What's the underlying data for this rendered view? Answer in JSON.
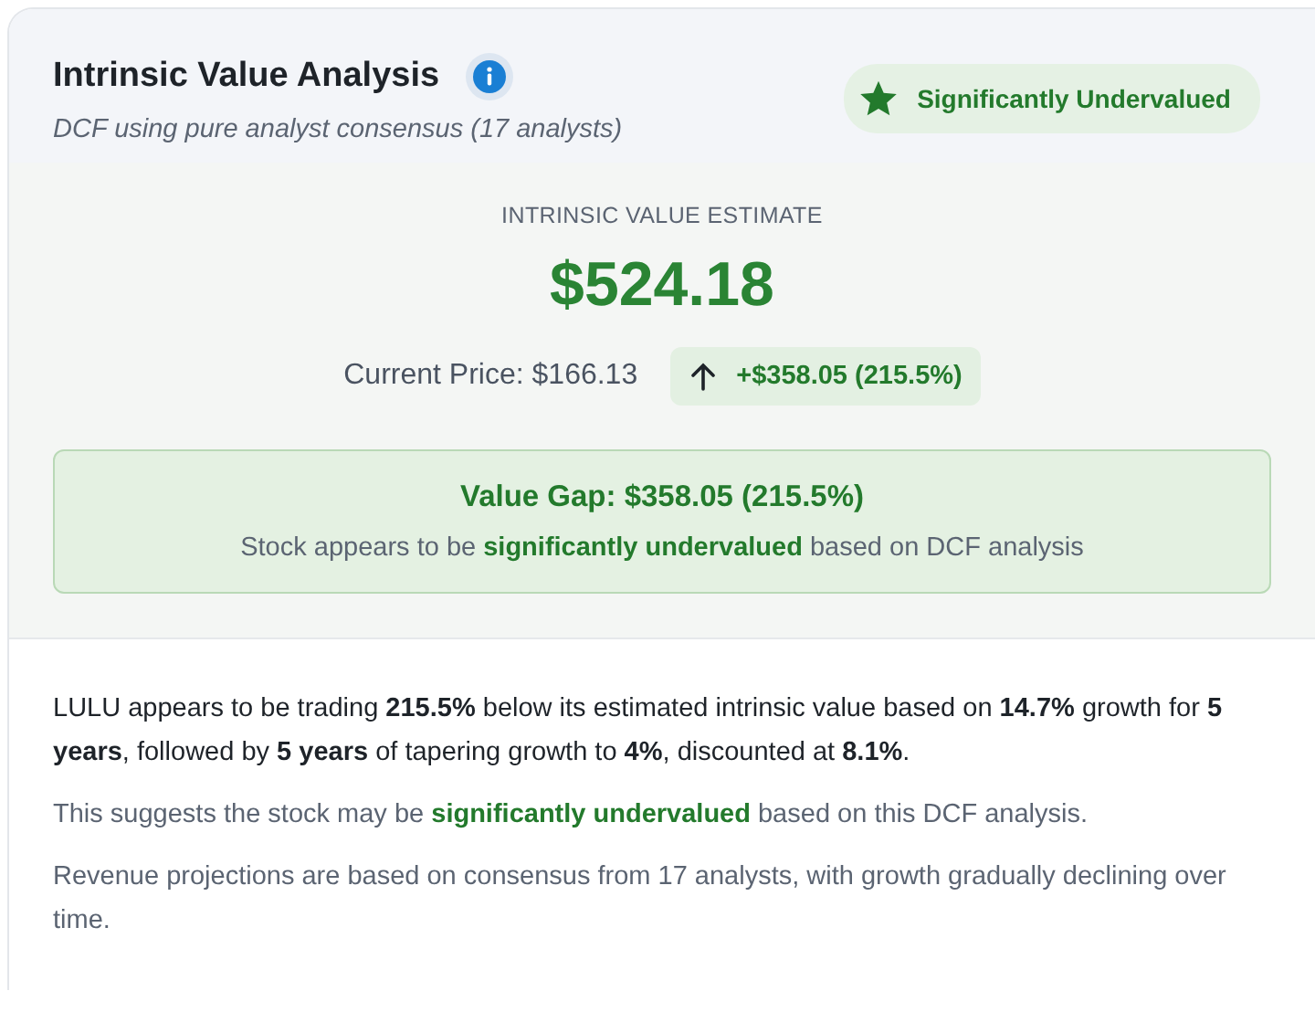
{
  "header": {
    "title": "Intrinsic Value Analysis",
    "subtitle": "DCF using pure analyst consensus (17 analysts)",
    "badge": {
      "label": "Significantly Undervalued"
    }
  },
  "estimate": {
    "label": "INTRINSIC VALUE ESTIMATE",
    "value": "$524.18",
    "current_price": "Current Price: $166.13",
    "change": "+$358.05 (215.5%)"
  },
  "value_gap": {
    "title": "Value Gap: $358.05 (215.5%)",
    "text": "Stock appears to be **significantly undervalued** based on DCF analysis"
  },
  "summary": [
    {
      "kind": "primary",
      "text": "LULU appears to be trading **215.5%** below its estimated intrinsic value based on **14.7%** growth for **5 years**, followed by **5 years** of tapering growth to **4%**, discounted at **8.1%**."
    },
    {
      "kind": "muted-highlight",
      "text": "This suggests the stock may be **significantly undervalued** based on this DCF analysis."
    },
    {
      "kind": "muted",
      "text": "Revenue projections are based on consensus from 17 analysts, with growth gradually declining over time."
    }
  ]
}
